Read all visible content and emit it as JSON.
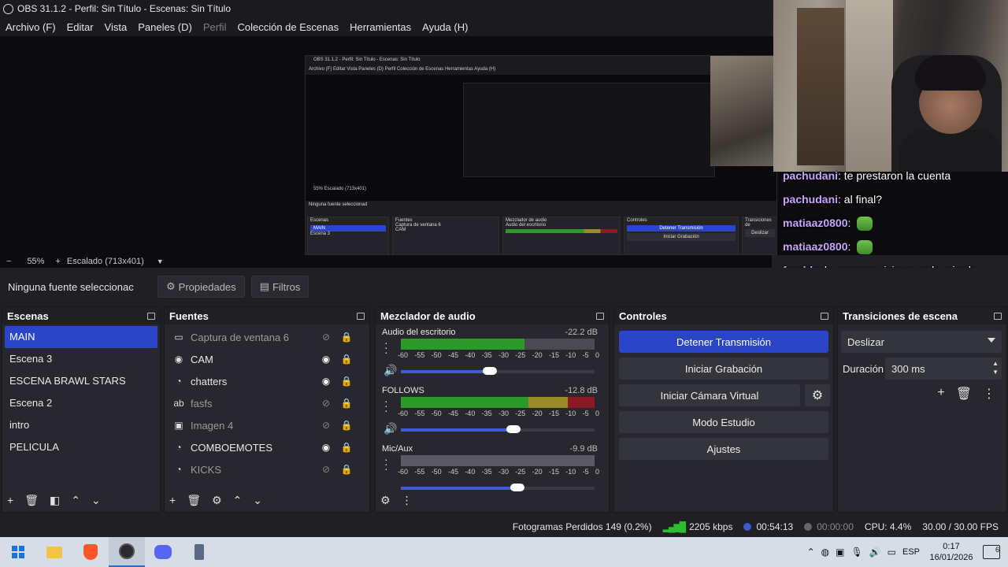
{
  "window": {
    "title": "OBS 31.1.2 - Perfil: Sin Título - Escenas: Sin Título"
  },
  "menu": [
    {
      "label": "Archivo (F)",
      "dim": false
    },
    {
      "label": "Editar",
      "dim": false
    },
    {
      "label": "Vista",
      "dim": false
    },
    {
      "label": "Paneles (D)",
      "dim": false
    },
    {
      "label": "Perfil",
      "dim": true
    },
    {
      "label": "Colección de Escenas",
      "dim": false
    },
    {
      "label": "Herramientas",
      "dim": false
    },
    {
      "label": "Ayuda (H)",
      "dim": false
    }
  ],
  "preview": {
    "zoom_minus": "−",
    "zoom_value": "55%",
    "zoom_plus": "+",
    "scaling": "Escalado (713x401)",
    "nested": {
      "title": "OBS 31.1.2 - Perfil: Sin Título - Escenas: Sin Título",
      "menu": "Archivo (F)  Editar  Vista  Paneles (D)  Perfil  Colección de Escenas  Herramientas  Ayuda (H)",
      "zoom": "55%   Escalado (713x401)",
      "none": "Ninguna fuente seleccionad",
      "scenes_title": "Escenas",
      "scene_main": "MAIN",
      "scene_3": "Escena 3",
      "sources_title": "Fuentes",
      "src1": "Captura de ventana 6",
      "src2": "CAM",
      "mixer_title": "Mezclador de audio",
      "mixer_ch": "Audio del escritorio",
      "controls_title": "Controles",
      "stop": "Detener Transmisión",
      "rec": "Iniciar Grabación",
      "trans_title": "Transiciones de",
      "trans_val": "Deslizar"
    }
  },
  "chat": [
    {
      "user": "pachudani",
      "text": ": te prestaron la cuenta",
      "emote": false
    },
    {
      "user": "pachudani",
      "text": ": al final?",
      "emote": false
    },
    {
      "user": "matiaaz0800",
      "text": ":",
      "emote": true
    },
    {
      "user": "matiaaz0800",
      "text": ":",
      "emote": true
    },
    {
      "user": "feerldz",
      "text": ": la comuna vivia re en la mierda",
      "emote": false
    }
  ],
  "source_toolbar": {
    "no_source": "Ninguna fuente seleccionac",
    "properties": "Propiedades",
    "filters": "Filtros"
  },
  "scenes": {
    "title": "Escenas",
    "items": [
      "MAIN",
      "Escena 3",
      "ESCENA BRAWL STARS",
      "Escena 2",
      "intro",
      "PELICULA"
    ],
    "selected": 0
  },
  "sources": {
    "title": "Fuentes",
    "items": [
      {
        "name": "Captura de ventana 6",
        "icon": "window-icon",
        "visible": false
      },
      {
        "name": "CAM",
        "icon": "camera-icon",
        "visible": true
      },
      {
        "name": "chatters",
        "icon": "browser-icon",
        "visible": true
      },
      {
        "name": "fasfs",
        "icon": "text-icon",
        "visible": false
      },
      {
        "name": "Imagen 4",
        "icon": "image-icon",
        "visible": false
      },
      {
        "name": "COMBOEMOTES",
        "icon": "browser-icon",
        "visible": true
      },
      {
        "name": "KICKS",
        "icon": "browser-icon",
        "visible": false
      }
    ]
  },
  "mixer": {
    "title": "Mezclador de audio",
    "ticks": [
      "-60",
      "-55",
      "-50",
      "-45",
      "-40",
      "-35",
      "-30",
      "-25",
      "-20",
      "-15",
      "-10",
      "-5",
      "0"
    ],
    "channels": [
      {
        "name": "Audio del escritorio",
        "db": "-22.2 dB",
        "volume": 0.46,
        "level": 0.64
      },
      {
        "name": "FOLLOWS",
        "db": "-12.8 dB",
        "volume": 0.58,
        "level": 0.8
      },
      {
        "name": "Mic/Aux",
        "db": "-9.9 dB",
        "volume": 0.6,
        "level": 0.0
      }
    ]
  },
  "controls": {
    "title": "Controles",
    "stop_stream": "Detener Transmisión",
    "start_recording": "Iniciar Grabación",
    "virtual_cam": "Iniciar Cámara Virtual",
    "studio_mode": "Modo Estudio",
    "settings": "Ajustes"
  },
  "transitions": {
    "title": "Transiciones de escena",
    "selected": "Deslizar",
    "duration_label": "Duración",
    "duration_value": "300 ms"
  },
  "status": {
    "dropped": "Fotogramas Perdidos 149 (0.2%)",
    "bitrate": "2205 kbps",
    "stream_time": "00:54:13",
    "rec_time": "00:00:00",
    "cpu": "CPU: 4.4%",
    "fps": "30.00 / 30.00 FPS"
  },
  "taskbar": {
    "lang": "ESP",
    "time": "0:17",
    "date": "16/01/2026",
    "notifications": "6"
  },
  "colors": {
    "accent": "#2a45c8",
    "meter_green": "#2b9a2b",
    "meter_yellow": "#9a8a2a",
    "meter_red": "#8a1a24"
  }
}
